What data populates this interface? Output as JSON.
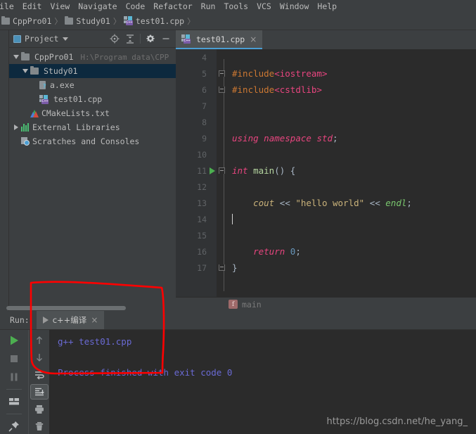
{
  "menubar": {
    "items": [
      {
        "label": "ile",
        "mnemonic": ""
      },
      {
        "label": "Edit",
        "mnemonic": "E"
      },
      {
        "label": "View",
        "mnemonic": "V"
      },
      {
        "label": "Navigate",
        "mnemonic": "N"
      },
      {
        "label": "Code",
        "mnemonic": "C"
      },
      {
        "label": "Refactor",
        "mnemonic": "R"
      },
      {
        "label": "Run",
        "mnemonic": "u"
      },
      {
        "label": "Tools",
        "mnemonic": "T"
      },
      {
        "label": "VCS",
        "mnemonic": "S"
      },
      {
        "label": "Window",
        "mnemonic": "W"
      },
      {
        "label": "Help",
        "mnemonic": "H"
      }
    ]
  },
  "navbar": {
    "crumbs": [
      {
        "label": "CppPro01",
        "icon": "folder-icon"
      },
      {
        "label": "Study01",
        "icon": "folder-icon"
      },
      {
        "label": "test01.cpp",
        "icon": "cpp-file-icon"
      }
    ],
    "separator": "〉"
  },
  "project_panel": {
    "title": "Project",
    "actions": [
      {
        "name": "locate-icon",
        "label": "Select Opened File"
      },
      {
        "name": "collapse-all-icon",
        "label": "Collapse All"
      },
      {
        "name": "gear-icon",
        "label": "Settings"
      },
      {
        "name": "hide-icon",
        "label": "Hide"
      }
    ],
    "tree": [
      {
        "label": "CppPro01",
        "path": "H:\\Program data\\CPP",
        "icon": "folder-icon",
        "expander": "down",
        "indent": 0,
        "selected": false
      },
      {
        "label": "Study01",
        "path": "",
        "icon": "folder-icon",
        "expander": "down",
        "indent": 1,
        "selected": true
      },
      {
        "label": "a.exe",
        "path": "",
        "icon": "unknown-file-icon",
        "expander": "none",
        "indent": 2,
        "selected": false
      },
      {
        "label": "test01.cpp",
        "path": "",
        "icon": "cpp-file-icon",
        "expander": "none",
        "indent": 2,
        "selected": false
      },
      {
        "label": "CMakeLists.txt",
        "path": "",
        "icon": "cmake-icon",
        "expander": "none",
        "indent": 1,
        "selected": false
      },
      {
        "label": "External Libraries",
        "path": "",
        "icon": "library-icon",
        "expander": "right",
        "indent": 0,
        "selected": false
      },
      {
        "label": "Scratches and Consoles",
        "path": "",
        "icon": "scratches-icon",
        "expander": "none",
        "indent": 0,
        "selected": false
      }
    ]
  },
  "editor": {
    "tab": {
      "label": "test01.cpp",
      "close": "×",
      "icon": "cpp-file-icon"
    },
    "breadcrumb": {
      "icon_letter": "f",
      "label": "main"
    },
    "lines": [
      {
        "num": "4",
        "runnable": false,
        "fold": "",
        "text": ""
      },
      {
        "num": "5",
        "runnable": false,
        "fold": "top",
        "text": "#include<iostream>"
      },
      {
        "num": "6",
        "runnable": false,
        "fold": "bot",
        "text": "#include<cstdlib>"
      },
      {
        "num": "7",
        "runnable": false,
        "fold": "",
        "text": ""
      },
      {
        "num": "8",
        "runnable": false,
        "fold": "",
        "text": ""
      },
      {
        "num": "9",
        "runnable": false,
        "fold": "",
        "text": "using namespace std;"
      },
      {
        "num": "10",
        "runnable": false,
        "fold": "",
        "text": ""
      },
      {
        "num": "11",
        "runnable": true,
        "fold": "top",
        "text": "int main() {"
      },
      {
        "num": "12",
        "runnable": false,
        "fold": "",
        "text": ""
      },
      {
        "num": "13",
        "runnable": false,
        "fold": "",
        "text": "    cout << \"hello world\" << endl;"
      },
      {
        "num": "14",
        "runnable": false,
        "fold": "",
        "text": ""
      },
      {
        "num": "15",
        "runnable": false,
        "fold": "",
        "text": ""
      },
      {
        "num": "16",
        "runnable": false,
        "fold": "",
        "text": "    return 0;"
      },
      {
        "num": "17",
        "runnable": false,
        "fold": "bot",
        "text": "}"
      }
    ]
  },
  "run_panel": {
    "title": "Run:",
    "tab": {
      "label": "c++编译",
      "close": "×",
      "icon": "play-icon"
    },
    "toolbar_left": [
      {
        "name": "rerun-icon",
        "label": "Rerun"
      },
      {
        "name": "stop-icon",
        "label": "Stop"
      },
      {
        "name": "pause-icon",
        "label": "Pause"
      },
      {
        "name": "layout-icon",
        "label": "Layout"
      },
      {
        "name": "pin-icon",
        "label": "Pin Tab"
      }
    ],
    "toolbar_right": [
      {
        "name": "arrow-up-icon",
        "label": "Up the stack trace"
      },
      {
        "name": "arrow-down-icon",
        "label": "Down the stack trace"
      },
      {
        "name": "soft-wrap-icon",
        "label": "Soft-Wrap"
      },
      {
        "name": "scroll-to-end-icon",
        "label": "Scroll to the end",
        "active": true
      },
      {
        "name": "print-icon",
        "label": "Print"
      },
      {
        "name": "trash-icon",
        "label": "Clear All"
      }
    ],
    "console": [
      "g++ test01.cpp",
      "Process finished with exit code 0"
    ]
  },
  "watermark": "https://blog.csdn.net/he_yang_",
  "colors": {
    "accent": "#4a9ed4",
    "editor_bg": "#2b2b2b",
    "panel_bg": "#3c3f41",
    "gutter_bg": "#313335",
    "selection_bg": "#0d293e",
    "console_text": "#6a6ad4",
    "annotation": "#ff0000",
    "run_arrow": "#4caf50"
  }
}
